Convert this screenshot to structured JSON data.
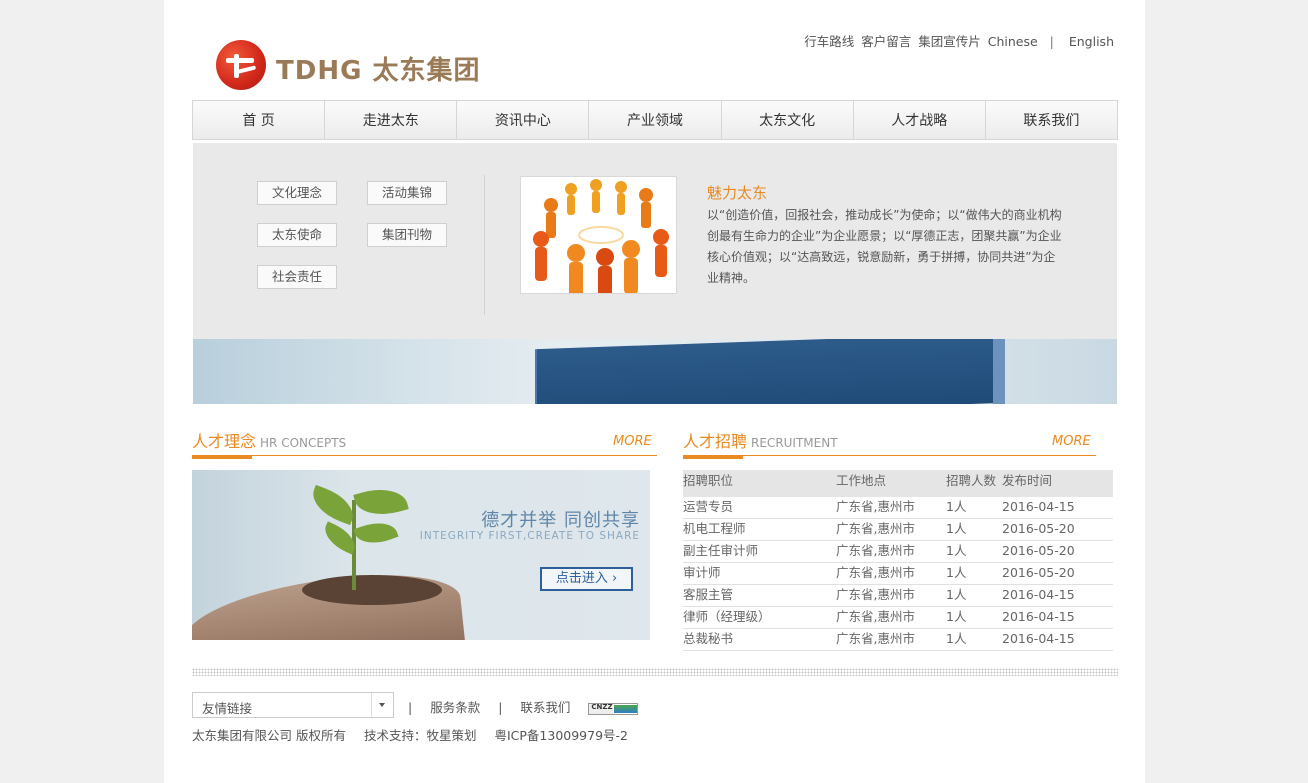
{
  "header": {
    "logo_text": "TDHG 太东集团",
    "top_links": [
      "行车路线",
      "客户留言",
      "集团宣传片",
      "Chinese"
    ],
    "lang_sep": "|",
    "lang_en": "English"
  },
  "nav": [
    "首 页",
    "走进太东",
    "资讯中心",
    "产业领域",
    "太东文化",
    "人才战略",
    "联系我们"
  ],
  "submenu": {
    "items": [
      "文化理念",
      "活动集锦",
      "太东使命",
      "集团刊物",
      "社会责任"
    ],
    "title": "魅力太东",
    "text": "以“创造价值，回报社会，推动成长”为使命；以“做伟大的商业机构创最有生命力的企业”为企业愿景；以“厚德正志，团聚共赢”为企业核心价值观；以“达高致远，锐意励新，勇于拼搏，协同共进”为企业精神。"
  },
  "hr_concepts": {
    "title": "人才理念",
    "title_en": "HR CONCEPTS",
    "more": "MORE",
    "slogan_cn": "德才并举   同创共享",
    "slogan_en": "INTEGRITY FIRST,CREATE TO SHARE",
    "enter_button": "点击进入 ›"
  },
  "recruitment": {
    "title": "人才招聘",
    "title_en": "RECRUITMENT",
    "more": "MORE",
    "columns": [
      "招聘职位",
      "工作地点",
      "招聘人数",
      "发布时间"
    ],
    "rows": [
      [
        "运营专员",
        "广东省,惠州市",
        "1人",
        "2016-04-15"
      ],
      [
        "机电工程师",
        "广东省,惠州市",
        "1人",
        "2016-05-20"
      ],
      [
        "副主任审计师",
        "广东省,惠州市",
        "1人",
        "2016-05-20"
      ],
      [
        "审计师",
        "广东省,惠州市",
        "1人",
        "2016-05-20"
      ],
      [
        "客服主管",
        "广东省,惠州市",
        "1人",
        "2016-04-15"
      ],
      [
        "律师（经理级）",
        "广东省,惠州市",
        "1人",
        "2016-04-15"
      ],
      [
        "总裁秘书",
        "广东省,惠州市",
        "1人",
        "2016-04-15"
      ]
    ]
  },
  "footer": {
    "friend_links": "友情链接",
    "sep": "|",
    "service_terms": "服务条款",
    "contact": "联系我们",
    "cnzz": "CNZZ",
    "copyright": "太东集团有限公司 版权所有",
    "tech_support": "技术支持：牧星策划",
    "icp": "粤ICP备13009979号-2"
  },
  "colors": {
    "accent": "#e98a22",
    "link_blue": "#2d5f9a"
  }
}
